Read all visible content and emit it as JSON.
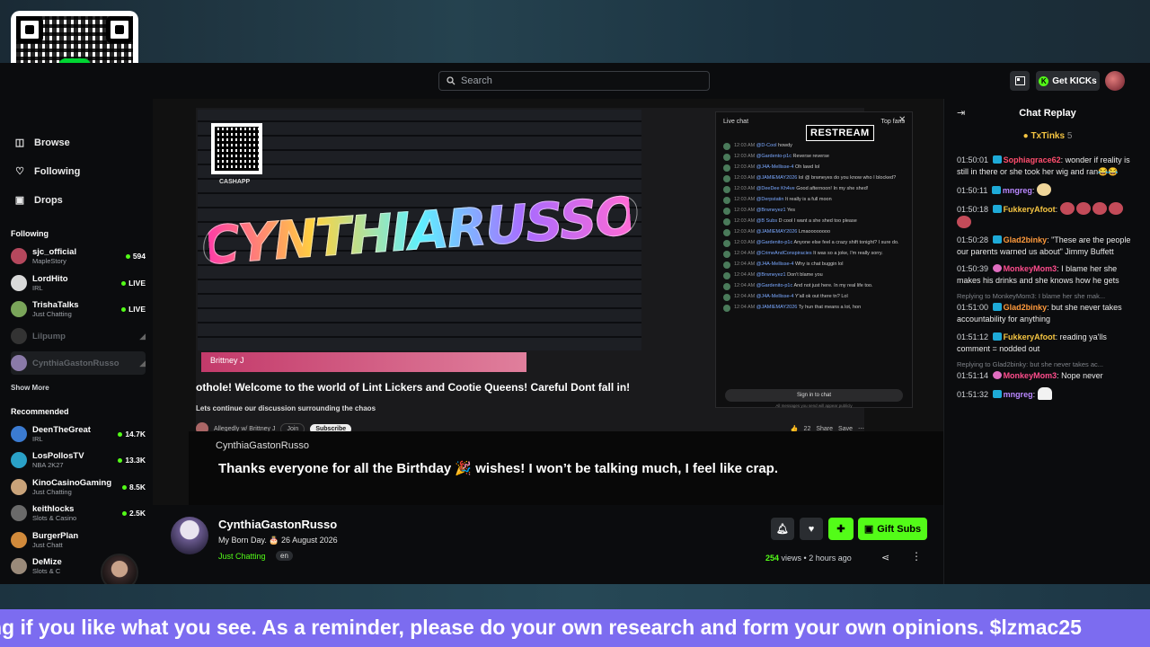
{
  "header": {
    "search_placeholder": "Search",
    "get_kicks": "Get KICKs"
  },
  "qr": {
    "logo": "$"
  },
  "sidebar": {
    "nav": [
      {
        "label": "Browse",
        "icon": "browse-icon"
      },
      {
        "label": "Following",
        "icon": "heart-icon"
      },
      {
        "label": "Drops",
        "icon": "gift-icon"
      }
    ],
    "following_title": "Following",
    "following": [
      {
        "name": "sjc_official",
        "sub": "MapleStory",
        "count": "594",
        "color": "#b5485d"
      },
      {
        "name": "LordHito",
        "sub": "IRL",
        "count": "LIVE",
        "color": "#d9d9d9"
      },
      {
        "name": "TrishaTalks",
        "sub": "Just Chatting",
        "count": "LIVE",
        "color": "#7aa55a"
      },
      {
        "name": "Lilpump",
        "sub": "",
        "count": "",
        "color": "#444"
      },
      {
        "name": "CynthiaGastonRusso",
        "sub": "",
        "count": "",
        "color": "#8a7aa8"
      }
    ],
    "show_more": "Show More",
    "recommended_title": "Recommended",
    "recommended": [
      {
        "name": "DeenTheGreat",
        "sub": "IRL",
        "count": "14.7K",
        "color": "#3b7bd1"
      },
      {
        "name": "LosPollosTV",
        "sub": "NBA 2K27",
        "count": "13.3K",
        "color": "#2aa1c7"
      },
      {
        "name": "KinoCasinoGaming",
        "sub": "Just Chatting",
        "count": "8.5K",
        "color": "#c9a37a"
      },
      {
        "name": "keithlocks",
        "sub": "Slots & Casino",
        "count": "2.5K",
        "color": "#6a6a6a"
      },
      {
        "name": "BurgerPlan",
        "sub": "Just Chatt",
        "count": "",
        "color": "#d18a3b"
      },
      {
        "name": "DeMize",
        "sub": "Slots & C",
        "count": "",
        "color": "#9a8a7a"
      }
    ]
  },
  "overlay": {
    "name_pill": "lzmac25"
  },
  "video": {
    "graffiti_text": "CYNTHIARUSSO",
    "qr_label": "CASHAPP",
    "lower_third": "Brittney J",
    "ticker": "othole!        Welcome to the world of Lint Lickers and Cootie Queens!  Careful Dont fall in!",
    "discussion": "Lets continue our discussion surrounding the chaos",
    "yt_channel": "Allegedly w/ Brittney J",
    "yt_join": "Join",
    "yt_subscribe": "Subscribe",
    "yt_likes": "22",
    "yt_share": "Share",
    "yt_save": "Save",
    "inset_live_chat": "Live chat",
    "inset_top": "Top fans",
    "restream": "RESTREAM",
    "inset_sign_in": "Sign in to chat",
    "inset_footer": "All messages you send will appear publicly",
    "inset_messages": [
      {
        "t": "12:03 AM",
        "u": "@D-Cool",
        "m": "howdy"
      },
      {
        "t": "12:03 AM",
        "u": "@Gardento-p1c",
        "m": "Reverse reverse"
      },
      {
        "t": "12:03 AM",
        "u": "@J4A-Mellisse-4",
        "m": "Oh lawd lol"
      },
      {
        "t": "12:03 AM",
        "u": "@JAMIEMAY2026",
        "m": "lol @ brwneyes do you know who I blocked?"
      },
      {
        "t": "12:03 AM",
        "u": "@DeeDee Kh4ve",
        "m": "Good afternoon! In my she shed!"
      },
      {
        "t": "12:03 AM",
        "u": "@Derpstatin",
        "m": "It really is a full moon"
      },
      {
        "t": "12:03 AM",
        "u": "@Brwneyez1",
        "m": "Yes"
      },
      {
        "t": "12:03 AM",
        "u": "@B Subs",
        "m": "D cool I want a she shed too please"
      },
      {
        "t": "12:03 AM",
        "u": "@JAMIEMAY2026",
        "m": "Lmaoooooooo"
      },
      {
        "t": "12:03 AM",
        "u": "@Gardenito-p1c",
        "m": "Anyone else feel a crazy shift tonight? I sure do."
      },
      {
        "t": "12:04 AM",
        "u": "@CrimeAndConspiracies",
        "m": "It was so a joke, I'm really sorry."
      },
      {
        "t": "12:04 AM",
        "u": "@J4A-Mellisse-4",
        "m": "Why is chat buggin lol"
      },
      {
        "t": "12:04 AM",
        "u": "@Brwneyez1",
        "m": "Don't blame you"
      },
      {
        "t": "12:04 AM",
        "u": "@Gardenito-p1c",
        "m": "And not just here. In my real life too."
      },
      {
        "t": "12:04 AM",
        "u": "@J4A-Mellisse-4",
        "m": "Y'all ok out there tn? Lol"
      },
      {
        "t": "12:04 AM",
        "u": "@JAMIEMAY2026",
        "m": "Ty hun that means a lot, hon"
      }
    ]
  },
  "caption": {
    "name": "CynthiaGastonRusso",
    "text": "Thanks everyone for all the Birthday 🎉 wishes! I won’t be talking much, I feel like crap."
  },
  "stream": {
    "name": "CynthiaGastonRusso",
    "title": "My Born Day. 🎂 26 August 2026",
    "category": "Just Chatting",
    "language": "en",
    "gift_subs": "Gift Subs",
    "views_count": "254",
    "views_label": " views",
    "ago": "2 hours ago"
  },
  "chat": {
    "title": "Chat Replay",
    "pinned_name": "TxTinks",
    "pinned_count": "5",
    "messages": [
      {
        "time": "01:50:01",
        "user": "Sophiagrace62",
        "color": "#ff4d6d",
        "text": "wonder if reality is still in there or she took her wig and ran😂😂"
      },
      {
        "time": "01:50:11",
        "user": "mngreg",
        "color": "#b987ff",
        "text": "",
        "emote": "smile"
      },
      {
        "time": "01:50:18",
        "user": "FukkeryAfoot",
        "color": "#f5c542",
        "text": "",
        "emote": "row"
      },
      {
        "time": "01:50:28",
        "user": "Glad2binky",
        "color": "#ff9a3c",
        "text": "\"These are the people our parents warned us about\" Jimmy Buffett"
      },
      {
        "time": "01:50:39",
        "user": "MonkeyMom3",
        "color": "#ff4d8d",
        "text": "I blame her she makes his drinks and she knows how he gets"
      },
      {
        "reply": "Replying to MonkeyMom3: I blame her she mak...",
        "time": "01:51:00",
        "user": "Glad2binky",
        "color": "#ff9a3c",
        "text": "but she never takes accountability for anything"
      },
      {
        "time": "01:51:12",
        "user": "FukkeryAfoot",
        "color": "#f5c542",
        "text": "reading ya'lls comment = nodded out"
      },
      {
        "reply": "Replying to Glad2binky: but she never takes ac...",
        "time": "01:51:14",
        "user": "MonkeyMom3",
        "color": "#ff4d8d",
        "text": "Nope never"
      },
      {
        "time": "01:51:32",
        "user": "mngreg",
        "color": "#b987ff",
        "text": "",
        "emote": "ghost"
      }
    ]
  },
  "marquee": {
    "text": "ng if you like what you see. As a reminder, please do your own research and form your own opinions. $lzmac25"
  },
  "colors": {
    "accent": "#53fc18",
    "marquee": "#7c6cf0"
  }
}
